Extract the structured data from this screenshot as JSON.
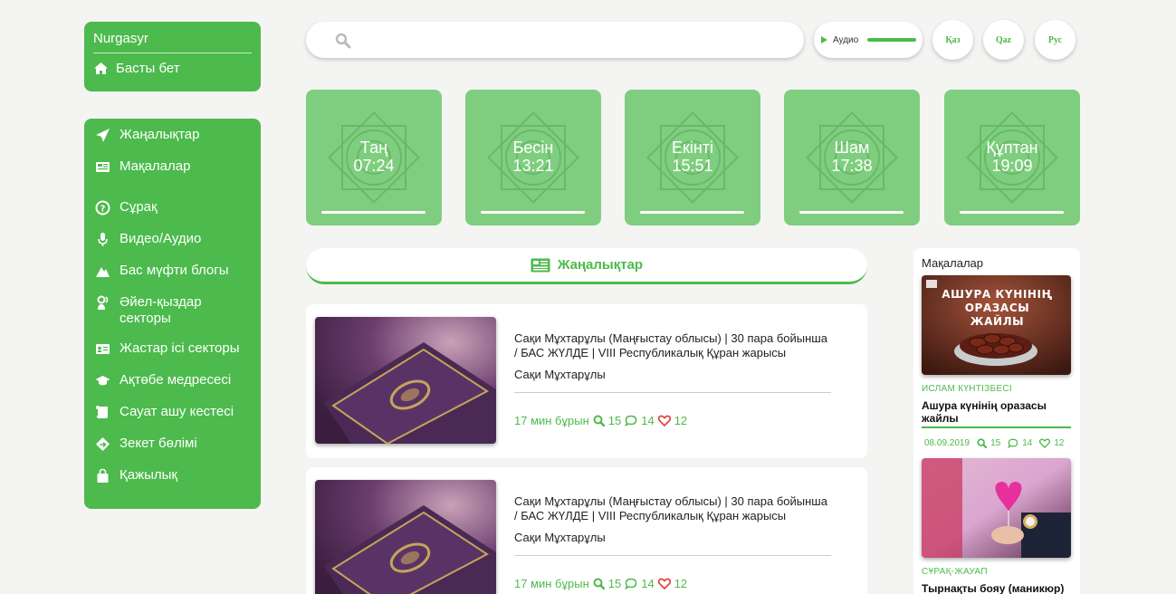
{
  "brand": {
    "name": "Nurgasyr",
    "home_label": "Басты бет"
  },
  "menu": [
    {
      "label": "Жаңалықтар",
      "icon": "paper-plane-icon"
    },
    {
      "label": "Мақалалар",
      "icon": "newspaper-icon"
    },
    {
      "label": "Сұрақ",
      "icon": "question-circle-icon"
    },
    {
      "label": "Видео/Аудио",
      "icon": "microphone-icon"
    },
    {
      "label": "Бас мүфти блогы",
      "icon": "mountain-icon"
    },
    {
      "label": "Әйел-қыздар секторы",
      "icon": "female-icon"
    },
    {
      "label": "Жастар ісі секторы",
      "icon": "id-card-icon"
    },
    {
      "label": "Ақтөбе медресесі",
      "icon": "graduation-cap-icon"
    },
    {
      "label": "Сауат ашу кестесі",
      "icon": "scroll-icon"
    },
    {
      "label": "Зекет бөлімі",
      "icon": "hand-holding-icon"
    },
    {
      "label": "Қажылық",
      "icon": "shopping-bag-icon"
    }
  ],
  "search": {
    "placeholder": ""
  },
  "audio": {
    "label": "Аудио"
  },
  "languages": [
    "Қаз",
    "Qaz",
    "Рус"
  ],
  "prayers": [
    {
      "name": "Таң",
      "time": "07:24"
    },
    {
      "name": "Бесін",
      "time": "13:21"
    },
    {
      "name": "Екінті",
      "time": "15:51"
    },
    {
      "name": "Шам",
      "time": "17:38"
    },
    {
      "name": "Құптан",
      "time": "19:09"
    }
  ],
  "news": {
    "header": "Жаңалықтар",
    "items": [
      {
        "title": "Сақи Мұхтарұлы (Маңғыстау облысы) | 30 пара бойынша / БАС ЖҮЛДЕ | VIII Республикалық Құран жарысы",
        "author": "Сақи Мұхтарұлы",
        "time": "17 мин бұрын",
        "views": "15",
        "comments": "14",
        "likes": "12"
      },
      {
        "title": "Сақи Мұхтарұлы (Маңғыстау облысы) | 30 пара бойынша / БАС ЖҮЛДЕ | VIII Республикалық Құран жарысы",
        "author": "Сақи Мұхтарұлы",
        "time": "17 мин бұрын",
        "views": "15",
        "comments": "14",
        "likes": "12"
      }
    ]
  },
  "articles": {
    "header": "Мақалалар",
    "items": [
      {
        "image_text": "АШУРА КҮНІНІҢ ОРАЗАСЫ ЖАЙЛЫ",
        "category": "ИСЛАМ КҮНТІЗБЕСІ",
        "title": "Ашура күнінің оразасы жайлы",
        "date": "08.09.2019",
        "views": "15",
        "comments": "14",
        "likes": "12"
      },
      {
        "category": "СҰРАҚ-ЖАУАП",
        "title": "Тырнақты бояу (маникюр)"
      }
    ]
  },
  "colors": {
    "accent": "#4cba4c",
    "tile": "#7fce7f",
    "background": "#f4f4f2"
  }
}
